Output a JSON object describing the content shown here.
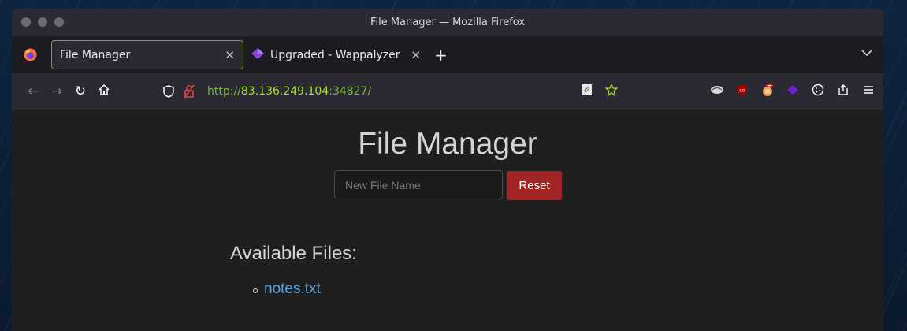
{
  "window": {
    "title": "File Manager — Mozilla Firefox"
  },
  "tabs": [
    {
      "label": "File Manager",
      "active": true
    },
    {
      "label": "Upgraded - Wappalyzer",
      "active": false
    }
  ],
  "navbar": {
    "url_protocol": "http://",
    "url_host": "83.136.249.104",
    "url_rest": ":34827/"
  },
  "page": {
    "heading": "File Manager",
    "input_placeholder": "New File Name",
    "input_value": "",
    "reset_label": "Reset",
    "files_heading": "Available Files:",
    "files": [
      "notes.txt"
    ]
  },
  "colors": {
    "accent_tab_border": "#7aa52a",
    "url_green": "#7cb342",
    "reset_button": "#a32424",
    "link": "#5ba3e0"
  },
  "icons": [
    "back-icon",
    "forward-icon",
    "reload-icon",
    "home-icon",
    "shield-icon",
    "insecure-lock-icon",
    "reader-view-icon",
    "bookmark-star-icon",
    "wappalyzer-icon",
    "ublock-icon",
    "extension-icon",
    "cookie-icon",
    "share-icon",
    "menu-icon"
  ]
}
